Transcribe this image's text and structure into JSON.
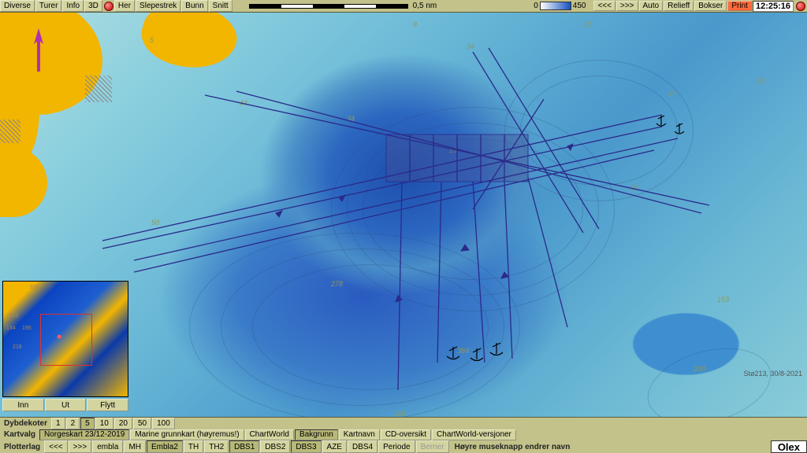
{
  "topbar": {
    "diverse": "Diverse",
    "turer": "Turer",
    "info": "Info",
    "td": "3D",
    "her": "Her",
    "slepestrek": "Slepestrek",
    "bunn": "Bunn",
    "snitt": "Snitt",
    "scale_label": "0,5 nm",
    "depth_min": "0",
    "depth_max": "450",
    "prev": "<<<",
    "next": ">>>",
    "auto": "Auto",
    "relieff": "Relieff",
    "bokser": "Bokser",
    "print": "Print",
    "clock": "12:25:16"
  },
  "depths": {
    "d5": "5",
    "d9": "9",
    "d12": "12",
    "d34a": "34",
    "d39": "39",
    "d44": "44",
    "d34b": "34",
    "d57": "57",
    "d19": "19",
    "d50": "50",
    "d278": "278",
    "d26": "26",
    "d110": "110",
    "d153": "153",
    "d200": "200",
    "d384": "384"
  },
  "minimap": {
    "inn": "Inn",
    "ut": "Ut",
    "flytt": "Flytt",
    "l_836": "836",
    "l_222": "222",
    "l_134": "134",
    "l_195": "195",
    "l_218": "218"
  },
  "corner": "Stø213, 30/8-2021",
  "dybdekoter": {
    "label": "Dybdekoter",
    "opts": [
      "1",
      "2",
      "5",
      "10",
      "20",
      "50",
      "100"
    ],
    "selected": "5"
  },
  "kartvalg": {
    "label": "Kartvalg",
    "norgeskart": "Norgeskart 23/12-2019",
    "marine": "Marine grunnkart (høyremus!)",
    "chartworld": "ChartWorld",
    "bakgrunn": "Bakgrunn",
    "kartnavn": "Kartnavn",
    "cd": "CD-oversikt",
    "cwver": "ChartWorld-versjoner"
  },
  "plotterlag": {
    "label": "Plotterlag",
    "prev": "<<<",
    "next": ">>>",
    "layers": [
      "embla",
      "MH",
      "Embla2",
      "TH",
      "TH2",
      "DBS1",
      "DBS2",
      "DBS3",
      "AZE",
      "DBS4"
    ],
    "selected": [
      "Embla2",
      "DBS1",
      "DBS3"
    ],
    "periode": "Periode",
    "berner": "Berner",
    "hint": "Høyre museknapp endrer navn"
  },
  "logo": "Olex"
}
